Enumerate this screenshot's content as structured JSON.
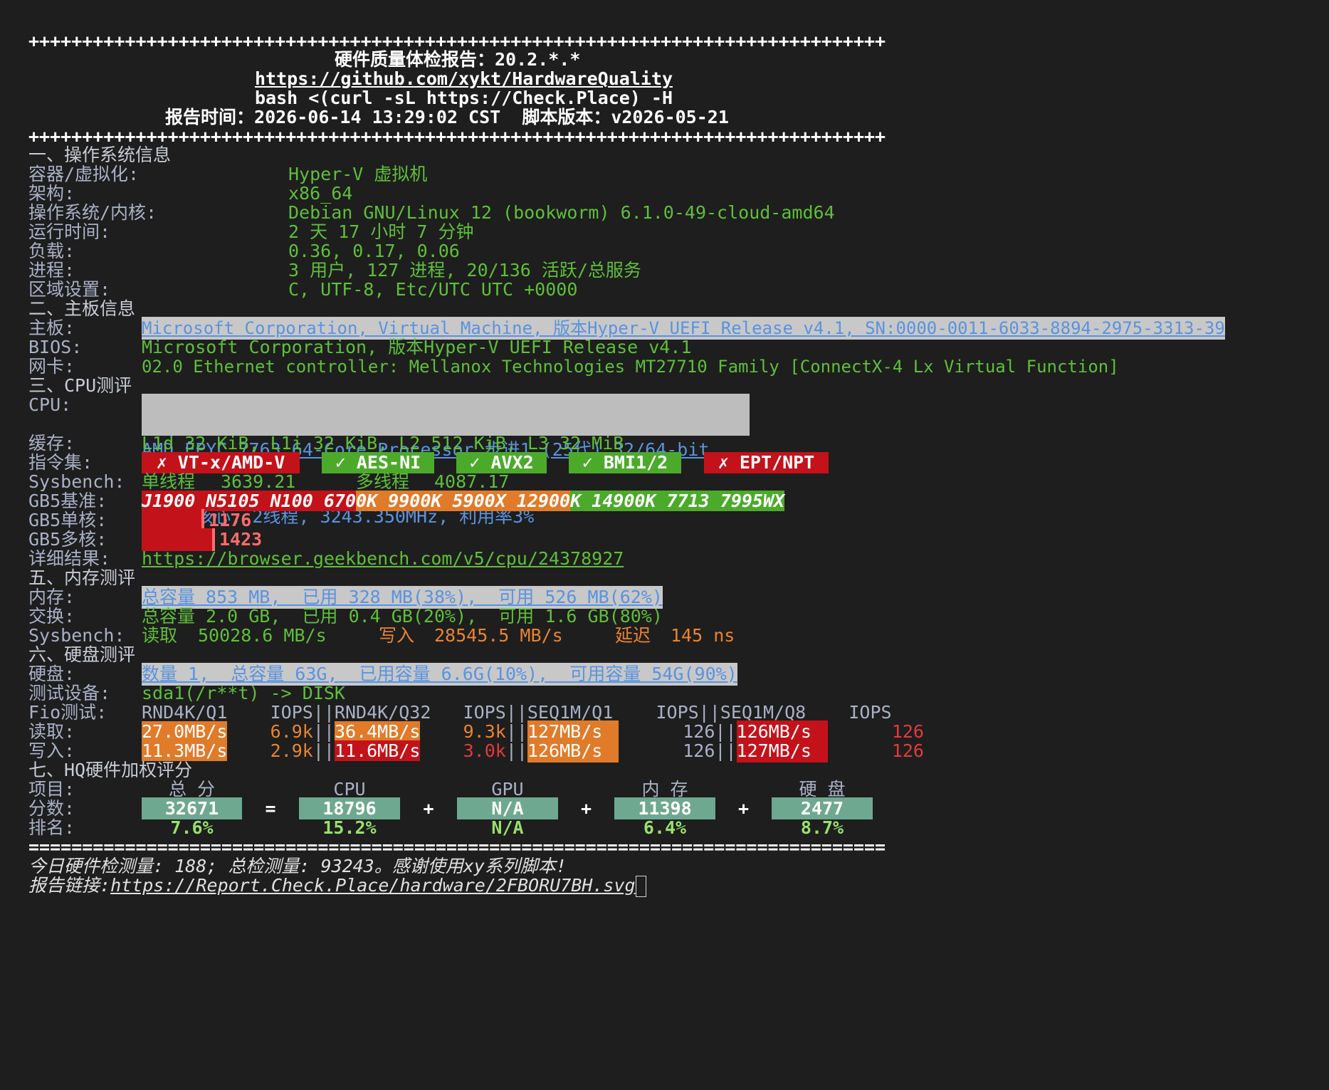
{
  "header": {
    "plus_line": "++++++++++++++++++++++++++++++++++++++++++++++++++++++++++++++++++++++++++++++++",
    "title": "硬件质量体检报告：20.2.*.*",
    "github_url": "https://github.com/xykt/HardwareQuality",
    "command": "bash <(curl -sL https://Check.Place) -H",
    "report_time_label": "报告时间：",
    "report_time": "2026-06-14 13:29:02 CST",
    "script_version_label": "脚本版本：",
    "script_version": "v2026-05-21"
  },
  "os": {
    "section": "一、操作系统信息",
    "rows": [
      {
        "label": "容器/虚拟化:",
        "value": "Hyper-V 虚拟机"
      },
      {
        "label": "架构:",
        "value": "x86_64"
      },
      {
        "label": "操作系统/内核:",
        "value": "Debian GNU/Linux 12 (bookworm) 6.1.0-49-cloud-amd64"
      },
      {
        "label": "运行时间:",
        "value": "2 天 17 小时 7 分钟"
      },
      {
        "label": "负载:",
        "value": "0.36, 0.17, 0.06"
      },
      {
        "label": "进程:",
        "value": "3 用户, 127 进程, 20/136 活跃/总服务"
      },
      {
        "label": "区域设置:",
        "value": "C, UTF-8, Etc/UTC UTC +0000"
      }
    ]
  },
  "board": {
    "section": "二、主板信息",
    "mb_label": "主板:",
    "mb_value": "Microsoft Corporation, Virtual Machine, 版本Hyper-V UEFI Release v4.1, SN:0000-0011-6033-8894-2975-3313-39",
    "bios_label": "BIOS:",
    "bios_value": "Microsoft Corporation, 版本Hyper-V UEFI Release v4.1",
    "nic_label": "网卡:",
    "nic_value": "02.0 Ethernet controller: Mellanox Technologies MT27710 Family [ConnectX-4 Lx Virtual Function]"
  },
  "cpu": {
    "section": "三、CPU测评",
    "cpu_label": "CPU:",
    "cpu_value": "AMD EPYC 7763 64-Core Processor 步进1 (25代) 32/64-bit",
    "cpu_sub": " ╚═ 1核心, 2线程, 3243.350MHz, 利用率3%",
    "cache_label": "缓存:",
    "cache_value": "L1d 32 KiB, L1i 32 KiB, L2 512 KiB, L3 32 MiB",
    "isa_label": "指令集:",
    "isa": [
      {
        "text": "✗ VT-x/AMD-V",
        "ok": false
      },
      {
        "text": "✓ AES-NI",
        "ok": true
      },
      {
        "text": "✓ AVX2",
        "ok": true
      },
      {
        "text": "✓ BMI1/2",
        "ok": true
      },
      {
        "text": "✗ EPT/NPT",
        "ok": false
      }
    ],
    "sysbench_label": "Sysbench:",
    "single_label": "单线程",
    "single_value": "3639.21",
    "multi_label": "多线程",
    "multi_value": "4087.17",
    "gb5_base_label": "GB5基准:",
    "gb5_base_red": "J1900 N5105 N100 670",
    "gb5_base_orange": "0K 9900K 5900X 12900",
    "gb5_base_green": "K 14900K 7713 7995WX",
    "gb5_single_label": "GB5单核:",
    "gb5_single_value": "1176",
    "gb5_multi_label": "GB5多核:",
    "gb5_multi_value": "1423",
    "detail_label": "详细结果:",
    "detail_url": "https://browser.geekbench.com/v5/cpu/24378927"
  },
  "mem": {
    "section": "五、内存测评",
    "mem_label": "内存:",
    "mem_value": "总容量 853 MB,  已用 328 MB(38%),  可用 526 MB(62%)",
    "swap_label": "交换:",
    "swap_value": "总容量 2.0 GB,  已用 0.4 GB(20%),  可用 1.6 GB(80%)",
    "sysbench_label": "Sysbench:",
    "read_label": "读取",
    "read_value": "50028.6 MB/s",
    "write_label": "写入",
    "write_value": "28545.5 MB/s",
    "lat_label": "延迟",
    "lat_value": "145 ns"
  },
  "disk": {
    "section": "六、硬盘测评",
    "disk_label": "硬盘:",
    "disk_value": "数量 1,  总容量 63G,  已用容量 6.6G(10%),  可用容量 54G(90%)",
    "dev_label": "测试设备:",
    "dev_value": "sda1(/r**t) -> DISK",
    "fio_label": "Fio测试:",
    "fio_header": "RND4K/Q1    IOPS||RND4K/Q32   IOPS||SEQ1M/Q1    IOPS||SEQ1M/Q8    IOPS",
    "read_label": "读取:",
    "write_label": "写入:",
    "read": [
      "27.0MB/s",
      "6.9k",
      "36.4MB/s",
      "9.3k",
      "127MB/s",
      "126",
      "126MB/s",
      "126"
    ],
    "write": [
      "11.3MB/s",
      "2.9k",
      "11.6MB/s",
      "3.0k",
      "126MB/s",
      "126",
      "127MB/s",
      "126"
    ]
  },
  "score": {
    "section": "七、HQ硬件加权评分",
    "item_label": "项目:",
    "score_label": "分数:",
    "rank_label": "排名:",
    "items": [
      "总 分",
      "CPU",
      "GPU",
      "内 存",
      "硬 盘"
    ],
    "scores": [
      "32671",
      "18796",
      "N/A",
      "11398",
      "2477"
    ],
    "ops": [
      "=",
      "+",
      "+",
      "+"
    ],
    "ranks": [
      "7.6%",
      "15.2%",
      "N/A",
      "6.4%",
      "8.7%"
    ]
  },
  "footer": {
    "eq_line": "================================================================================",
    "count_line": "今日硬件检测量: 188; 总检测量: 93243。感谢使用xy系列脚本!",
    "report_label": "报告链接:",
    "report_url": "https://Report.Check.Place/hardware/2FBORU7BH.svg"
  }
}
